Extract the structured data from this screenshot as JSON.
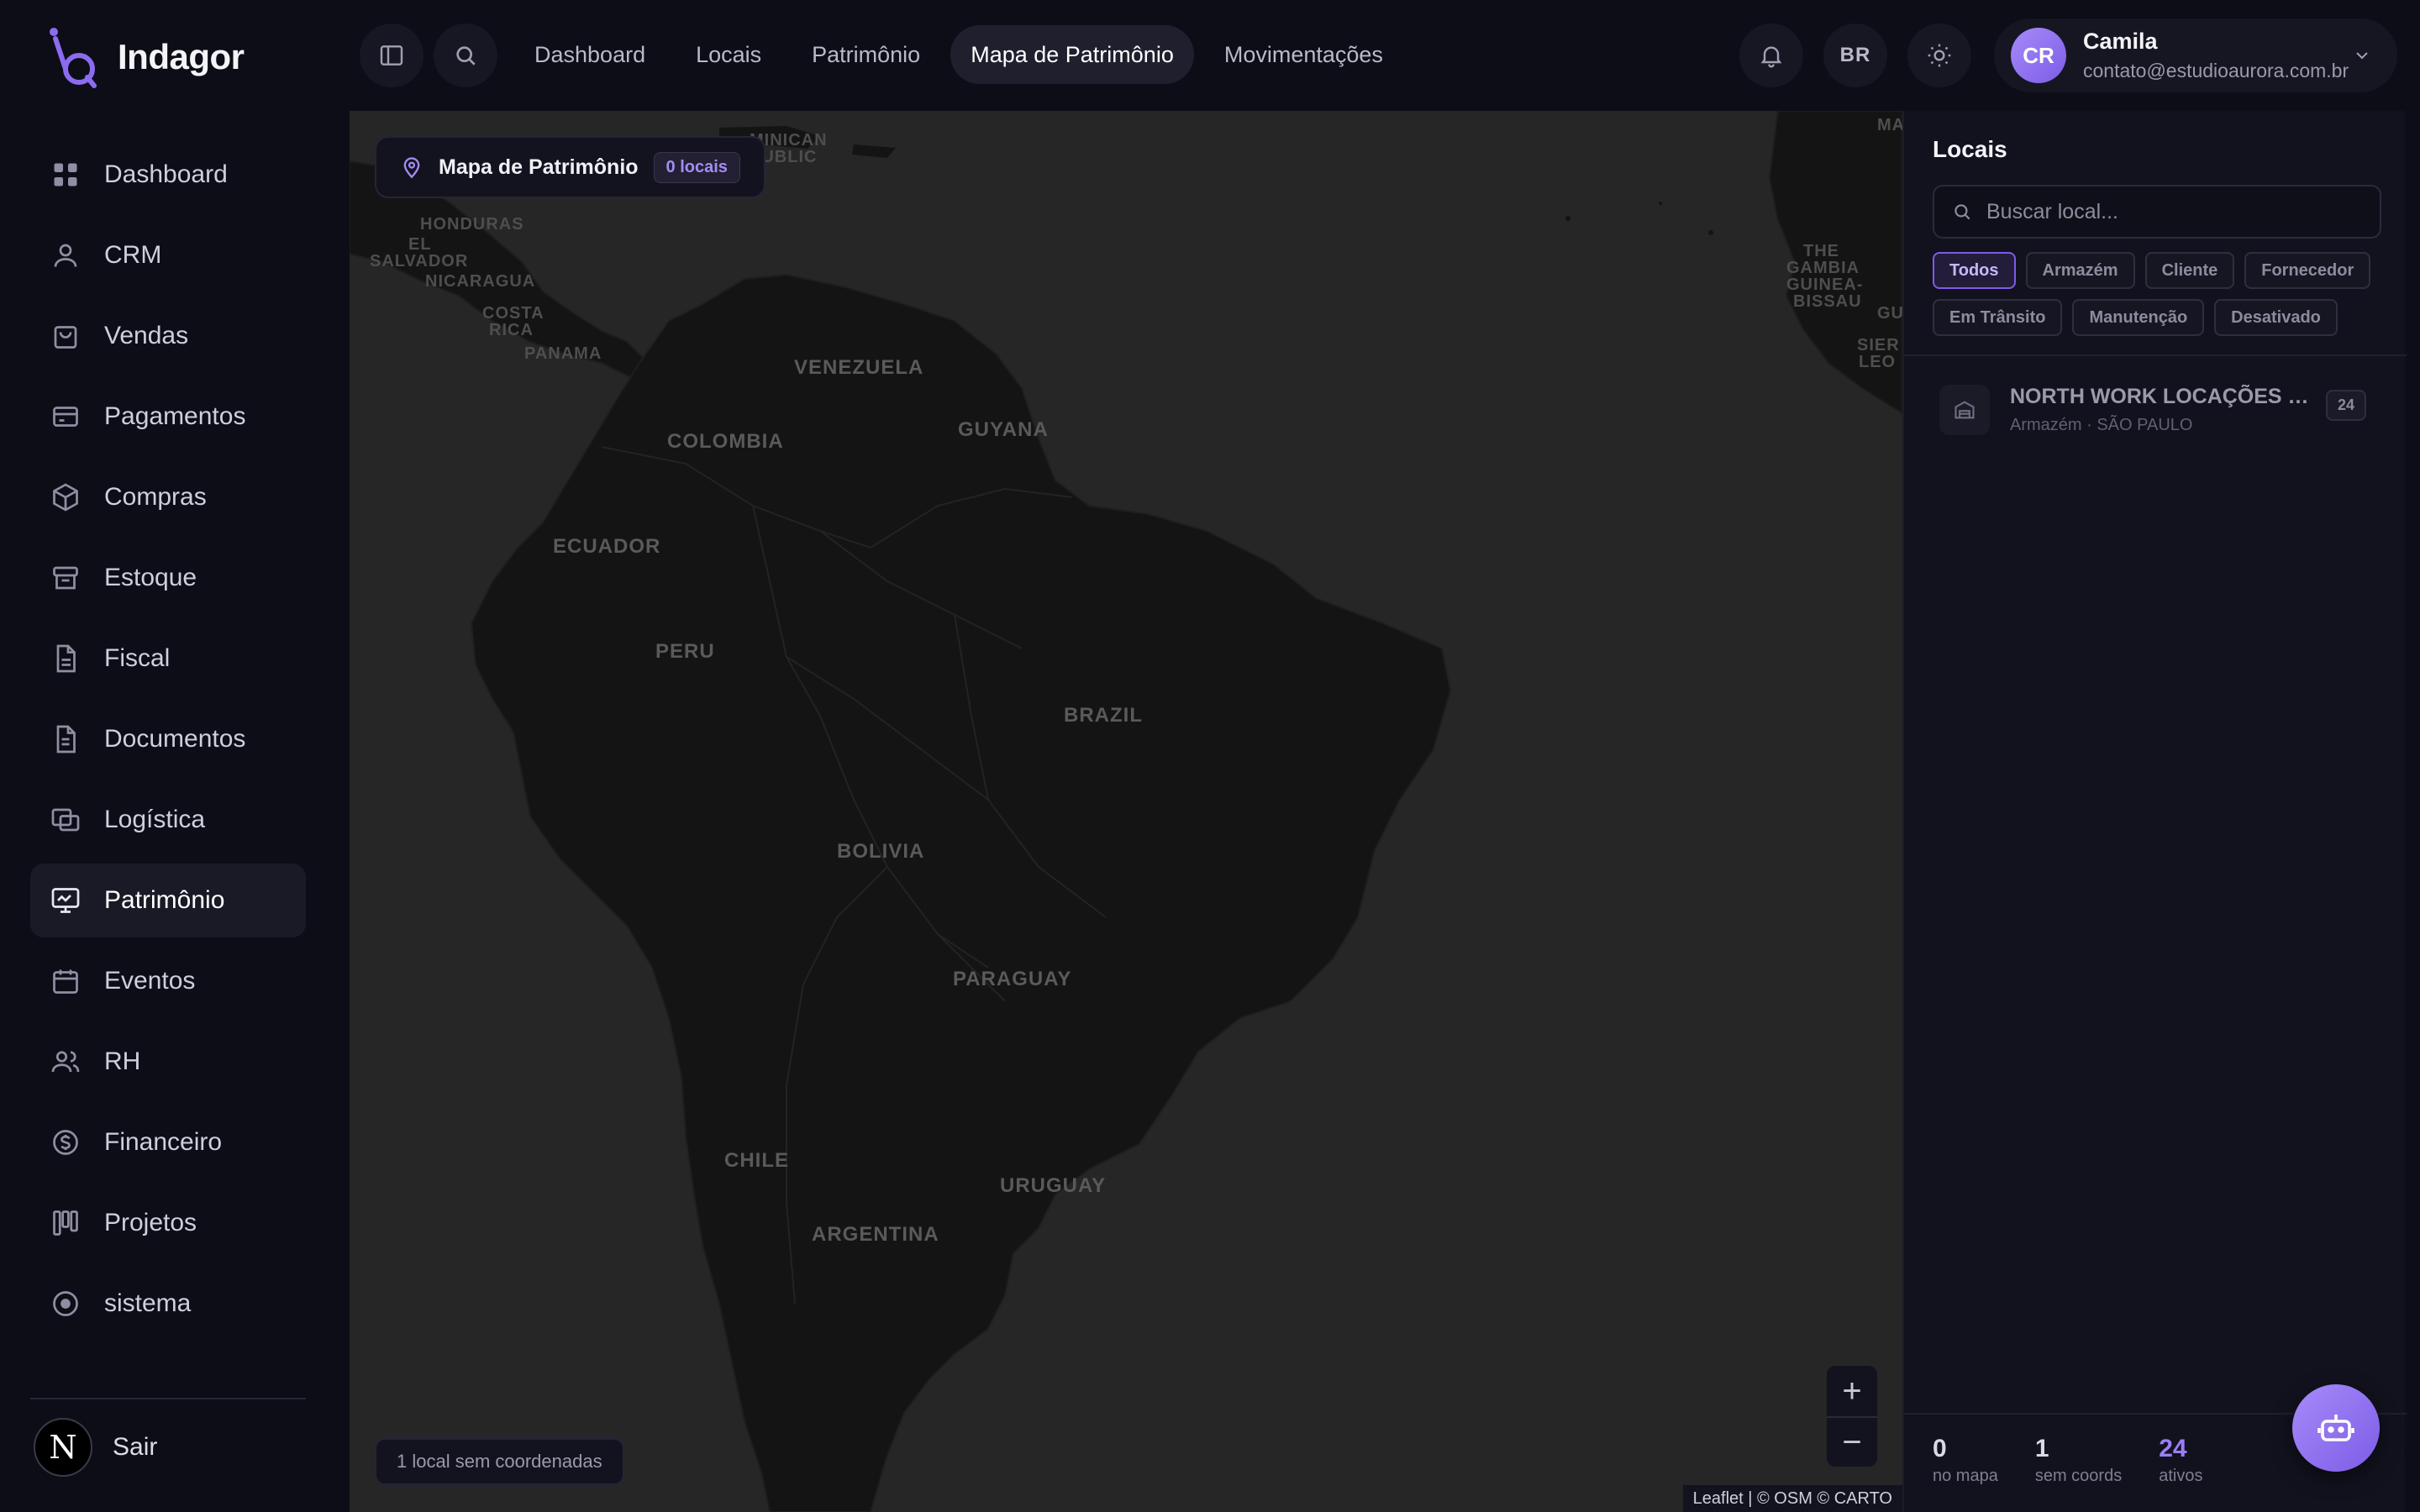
{
  "app": {
    "name": "Indagor"
  },
  "sidebar": {
    "items": [
      {
        "label": "Dashboard",
        "icon": "grid-icon",
        "active": false
      },
      {
        "label": "CRM",
        "icon": "user-icon",
        "active": false
      },
      {
        "label": "Vendas",
        "icon": "shopping-bag-icon",
        "active": false
      },
      {
        "label": "Pagamentos",
        "icon": "credit-card-icon",
        "active": false
      },
      {
        "label": "Compras",
        "icon": "box-icon",
        "active": false
      },
      {
        "label": "Estoque",
        "icon": "inventory-icon",
        "active": false
      },
      {
        "label": "Fiscal",
        "icon": "document-icon",
        "active": false
      },
      {
        "label": "Documentos",
        "icon": "file-icon",
        "active": false
      },
      {
        "label": "Logística",
        "icon": "logistics-icon",
        "active": false
      },
      {
        "label": "Patrimônio",
        "icon": "monitor-icon",
        "active": true
      },
      {
        "label": "Eventos",
        "icon": "calendar-icon",
        "active": false
      },
      {
        "label": "RH",
        "icon": "users-icon",
        "active": false
      },
      {
        "label": "Financeiro",
        "icon": "money-icon",
        "active": false
      },
      {
        "label": "Projetos",
        "icon": "kanban-icon",
        "active": false
      },
      {
        "label": "sistema",
        "icon": "circle-icon",
        "active": false
      }
    ],
    "logout": {
      "label": "Sair",
      "avatar_letter": "N"
    }
  },
  "topbar": {
    "nav": [
      {
        "label": "Dashboard",
        "active": false
      },
      {
        "label": "Locais",
        "active": false
      },
      {
        "label": "Patrimônio",
        "active": false
      },
      {
        "label": "Mapa de Patrimônio",
        "active": true
      },
      {
        "label": "Movimentações",
        "active": false
      }
    ],
    "language": "BR",
    "user": {
      "initials": "CR",
      "name": "Camila",
      "email": "contato@estudioaurora.com.br"
    }
  },
  "map": {
    "title": "Mapa de Patrimônio",
    "badge": "0 locais",
    "zoom_in": "+",
    "zoom_out": "−",
    "no_coords_text": "1 local sem coordenadas",
    "attribution": "Leaflet | © OSM © CARTO",
    "labels": [
      "VENEZUELA",
      "GUYANA",
      "COLOMBIA",
      "ECUADOR",
      "PERU",
      "BRAZIL",
      "BOLIVIA",
      "PARAGUAY",
      "CHILE",
      "URUGUAY",
      "ARGENTINA",
      "HONDURAS",
      "EL",
      "SALVADOR",
      "NICARAGUA",
      "COSTA",
      "RICA",
      "PANAMA",
      "MINICAN",
      "PUBLIC",
      "THE",
      "GAMBIA",
      "GUINEA-",
      "BISSAU",
      "MA",
      "GU",
      "SIER",
      "LEO"
    ]
  },
  "panel": {
    "title": "Locais",
    "search_placeholder": "Buscar local...",
    "filters": [
      {
        "label": "Todos",
        "active": true
      },
      {
        "label": "Armazém",
        "active": false
      },
      {
        "label": "Cliente",
        "active": false
      },
      {
        "label": "Fornecedor",
        "active": false
      },
      {
        "label": "Em Trânsito",
        "active": false
      },
      {
        "label": "Manutenção",
        "active": false
      },
      {
        "label": "Desativado",
        "active": false
      }
    ],
    "locations": [
      {
        "name": "NORTH WORK LOCAÇÕES LT...",
        "subtitle": "Armazém · SÃO PAULO",
        "count": "24"
      }
    ],
    "stats": [
      {
        "value": "0",
        "label": "no mapa",
        "accent": false
      },
      {
        "value": "1",
        "label": "sem coords",
        "accent": false
      },
      {
        "value": "24",
        "label": "ativos",
        "accent": true
      }
    ]
  },
  "colors": {
    "accent": "#7c5ce6",
    "accent_light": "#a78bfa",
    "background": "#0d0d18",
    "map_land": "#141414",
    "map_water": "#262626"
  }
}
